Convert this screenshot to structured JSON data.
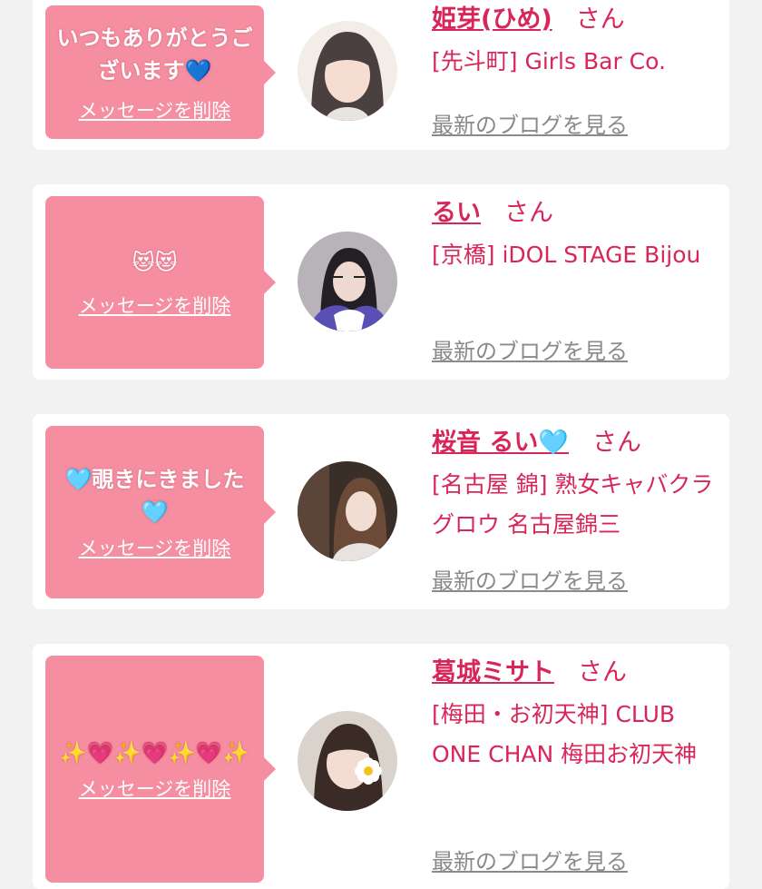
{
  "delete_label": "メッセージを削除",
  "san_label": "さん",
  "blog_label": "最新のブログを見る",
  "items": [
    {
      "message": "いつもありがとうございます💙",
      "name": "姫芽(ひめ)",
      "shop": "[先斗町] Girls Bar Co."
    },
    {
      "message": "😻😻",
      "name": "るい",
      "shop": "[京橋] iDOL STAGE Bijou"
    },
    {
      "message": "🩵覗きにきました🩵",
      "name": "桜音 るい🩵",
      "shop": "[名古屋 錦] 熟女キャバクラグロウ 名古屋錦三"
    },
    {
      "message": "✨💗✨💗✨💗✨",
      "name": "葛城ミサト",
      "shop": "[梅田・お初天神] CLUB ONE CHAN 梅田お初天神"
    }
  ],
  "colors": {
    "bubble": "#f58ea0",
    "name": "#d8265a",
    "link_gray": "#8a8a8a",
    "background": "#f2f2f2"
  }
}
